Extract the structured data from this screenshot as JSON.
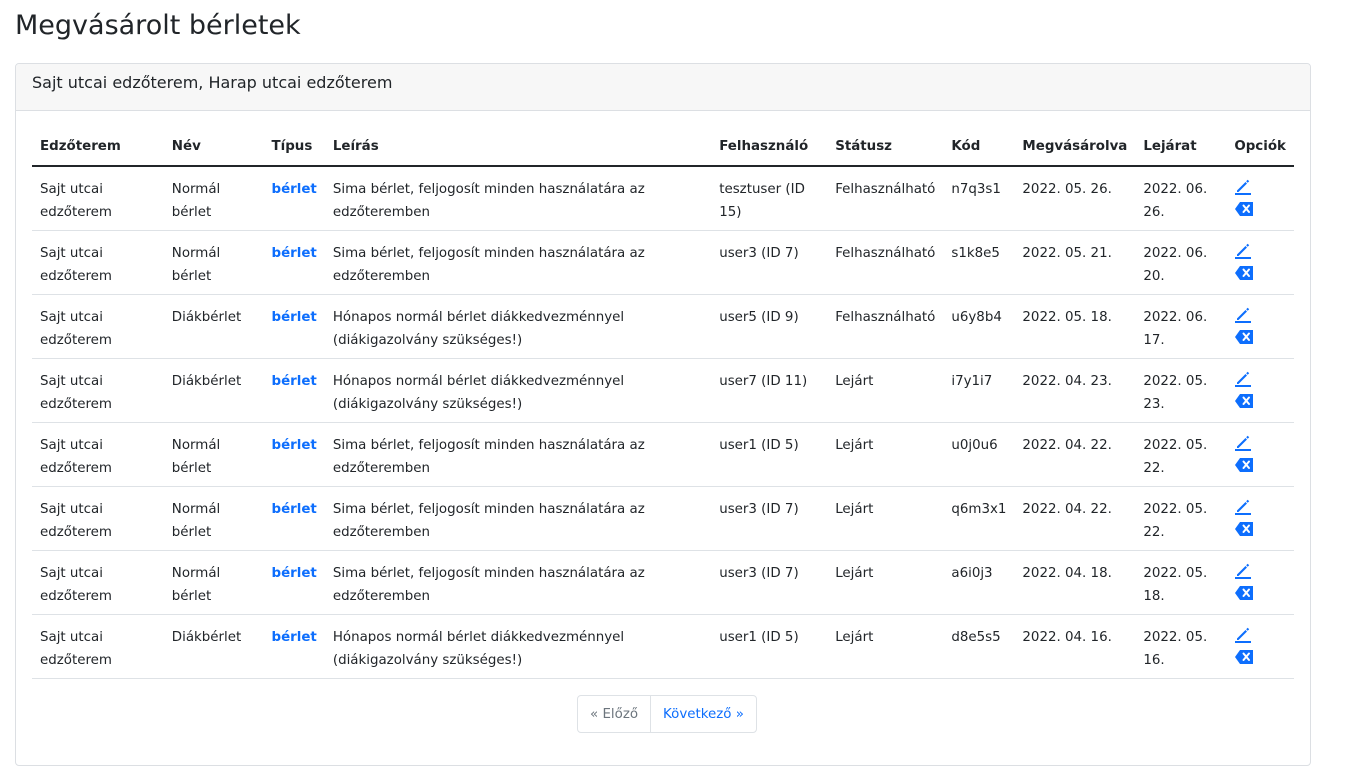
{
  "page": {
    "title": "Megvásárolt bérletek"
  },
  "card": {
    "header": "Sajt utcai edzőterem, Harap utcai edzőterem"
  },
  "table": {
    "columns": [
      "Edzőterem",
      "Név",
      "Típus",
      "Leírás",
      "Felhasználó",
      "Státusz",
      "Kód",
      "Megvásárolva",
      "Lejárat",
      "Opciók"
    ],
    "rows": [
      [
        "Sajt utcai edzőterem",
        "Normál bérlet",
        "bérlet",
        "Sima bérlet, feljogosít minden használatára az edzőteremben",
        "tesztuser (ID 15)",
        "Felhasználható",
        "n7q3s1",
        "2022. 05. 26.",
        "2022. 06. 26."
      ],
      [
        "Sajt utcai edzőterem",
        "Normál bérlet",
        "bérlet",
        "Sima bérlet, feljogosít minden használatára az edzőteremben",
        "user3 (ID 7)",
        "Felhasználható",
        "s1k8e5",
        "2022. 05. 21.",
        "2022. 06. 20."
      ],
      [
        "Sajt utcai edzőterem",
        "Diákbérlet",
        "bérlet",
        "Hónapos normál bérlet diákkedvezménnyel (diákigazolvány szükséges!)",
        "user5 (ID 9)",
        "Felhasználható",
        "u6y8b4",
        "2022. 05. 18.",
        "2022. 06. 17."
      ],
      [
        "Sajt utcai edzőterem",
        "Diákbérlet",
        "bérlet",
        "Hónapos normál bérlet diákkedvezménnyel (diákigazolvány szükséges!)",
        "user7 (ID 11)",
        "Lejárt",
        "i7y1i7",
        "2022. 04. 23.",
        "2022. 05. 23."
      ],
      [
        "Sajt utcai edzőterem",
        "Normál bérlet",
        "bérlet",
        "Sima bérlet, feljogosít minden használatára az edzőteremben",
        "user1 (ID 5)",
        "Lejárt",
        "u0j0u6",
        "2022. 04. 22.",
        "2022. 05. 22."
      ],
      [
        "Sajt utcai edzőterem",
        "Normál bérlet",
        "bérlet",
        "Sima bérlet, feljogosít minden használatára az edzőteremben",
        "user3 (ID 7)",
        "Lejárt",
        "q6m3x1",
        "2022. 04. 22.",
        "2022. 05. 22."
      ],
      [
        "Sajt utcai edzőterem",
        "Normál bérlet",
        "bérlet",
        "Sima bérlet, feljogosít minden használatára az edzőteremben",
        "user3 (ID 7)",
        "Lejárt",
        "a6i0j3",
        "2022. 04. 18.",
        "2022. 05. 18."
      ],
      [
        "Sajt utcai edzőterem",
        "Diákbérlet",
        "bérlet",
        "Hónapos normál bérlet diákkedvezménnyel (diákigazolvány szükséges!)",
        "user1 (ID 5)",
        "Lejárt",
        "d8e5s5",
        "2022. 04. 16.",
        "2022. 05. 16."
      ]
    ],
    "option_icons": [
      "pencil-icon",
      "delete-icon"
    ]
  },
  "pagination": {
    "prev_label": "« Előző",
    "next_label": "Következő »"
  },
  "colors": {
    "link": "#0d6efd",
    "muted": "#6c757d",
    "text": "#212529"
  }
}
